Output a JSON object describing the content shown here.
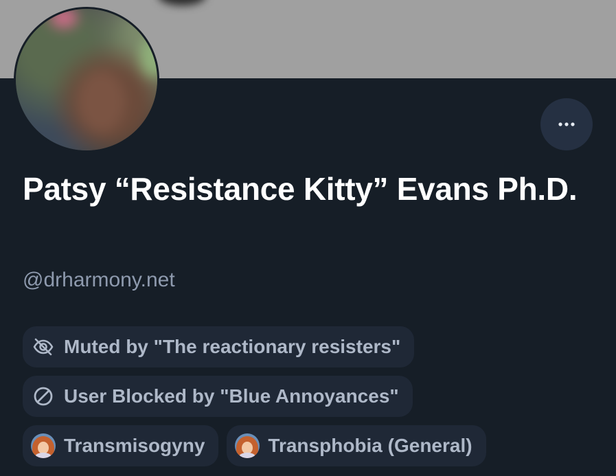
{
  "profile": {
    "display_name": "Patsy “Resistance Kitty” Evans Ph.D.",
    "handle": "@drharmony.net"
  },
  "labels": [
    {
      "icon": "eye-slash-icon",
      "text": "Muted by \"The reactionary resisters\""
    },
    {
      "icon": "block-icon",
      "text": "User Blocked by \"Blue Annoyances\""
    },
    {
      "icon": "labeler-avatar-icon",
      "text": "Transmisogyny"
    },
    {
      "icon": "labeler-avatar-icon",
      "text": "Transphobia (General)"
    }
  ],
  "colors": {
    "background": "#161e27",
    "banner": "#a0a0a0",
    "chip_background": "#1f2836",
    "chip_text": "#aeb8c8",
    "handle_text": "#8e9aae",
    "more_button": "#253042"
  }
}
